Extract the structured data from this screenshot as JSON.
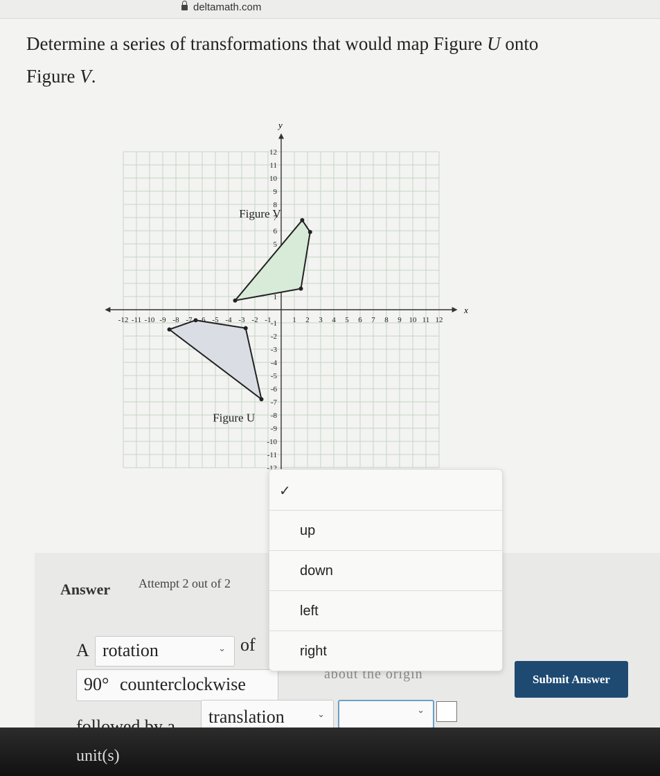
{
  "browser": {
    "url": "deltamath.com"
  },
  "question": {
    "line1_prefix": "Determine a series of transformations that would map Figure ",
    "figure_from": "U",
    "line1_suffix": " onto",
    "line2_prefix": "Figure ",
    "figure_to": "V",
    "line2_suffix": "."
  },
  "graph": {
    "x_axis_label": "x",
    "y_axis_label": "y",
    "x_ticks": [
      -12,
      -11,
      -10,
      -9,
      -8,
      -7,
      -6,
      -5,
      -4,
      -3,
      -2,
      -1,
      1,
      2,
      3,
      4,
      5,
      6,
      7,
      8,
      9,
      10,
      11,
      12
    ],
    "y_ticks": [
      12,
      11,
      10,
      9,
      8,
      7,
      6,
      5,
      4,
      3,
      2,
      1,
      -1,
      -2,
      -3,
      -4,
      -5,
      -6,
      -7,
      -8,
      -9,
      -10,
      -11,
      -12
    ],
    "figure_v_label": "Figure V",
    "figure_u_label": "Figure U",
    "figure_v_vertices": [
      [
        -3.5,
        0.7
      ],
      [
        1.5,
        1.6
      ],
      [
        2.2,
        5.9
      ],
      [
        1.6,
        6.8
      ]
    ],
    "figure_u_vertices": [
      [
        -8.5,
        -1.5
      ],
      [
        -6.5,
        -0.8
      ],
      [
        -2.7,
        -1.4
      ],
      [
        -1.5,
        -6.8
      ]
    ],
    "figure_v_color": "#d8ead8",
    "figure_u_color": "#dadde3"
  },
  "answer": {
    "title": "Answer",
    "attempt": "Attempt 2 out of 2",
    "a_label": "A",
    "transform1": "rotation",
    "of_label": "of",
    "angle": "90°",
    "direction": "counterclockwise",
    "about_text": "about the origin",
    "followed_label": "followed by a",
    "transform2": "translation",
    "units_label": "unit(s)",
    "submit_label": "Submit Answer"
  },
  "dropdown": {
    "checkmark": "✓",
    "options": [
      "up",
      "down",
      "left",
      "right"
    ]
  }
}
